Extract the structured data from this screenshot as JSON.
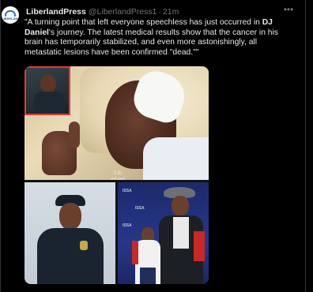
{
  "tweet": {
    "author_name": "LiberlandPress",
    "author_handle": "@LiberlandPress1",
    "separator": "·",
    "timestamp": "21m",
    "more_icon": "more-horizontal-icon",
    "text_part1": "\"A turning point that left everyone speechless has just occurred in ",
    "text_bold": "DJ Daniel",
    "text_part2": "'s journey. The latest medical results show that the cancer in his brain has temporarily stabilized, and even more astonishingly, all metastatic lesions have been confirmed \"dead.\"\""
  },
  "avatar": {
    "label": "LIBERLAND"
  },
  "media": {
    "watermark": "Lib erland"
  },
  "colors": {
    "background": "#000000",
    "text": "#e7e9ea",
    "muted": "#71767b",
    "border": "#2f3336"
  }
}
